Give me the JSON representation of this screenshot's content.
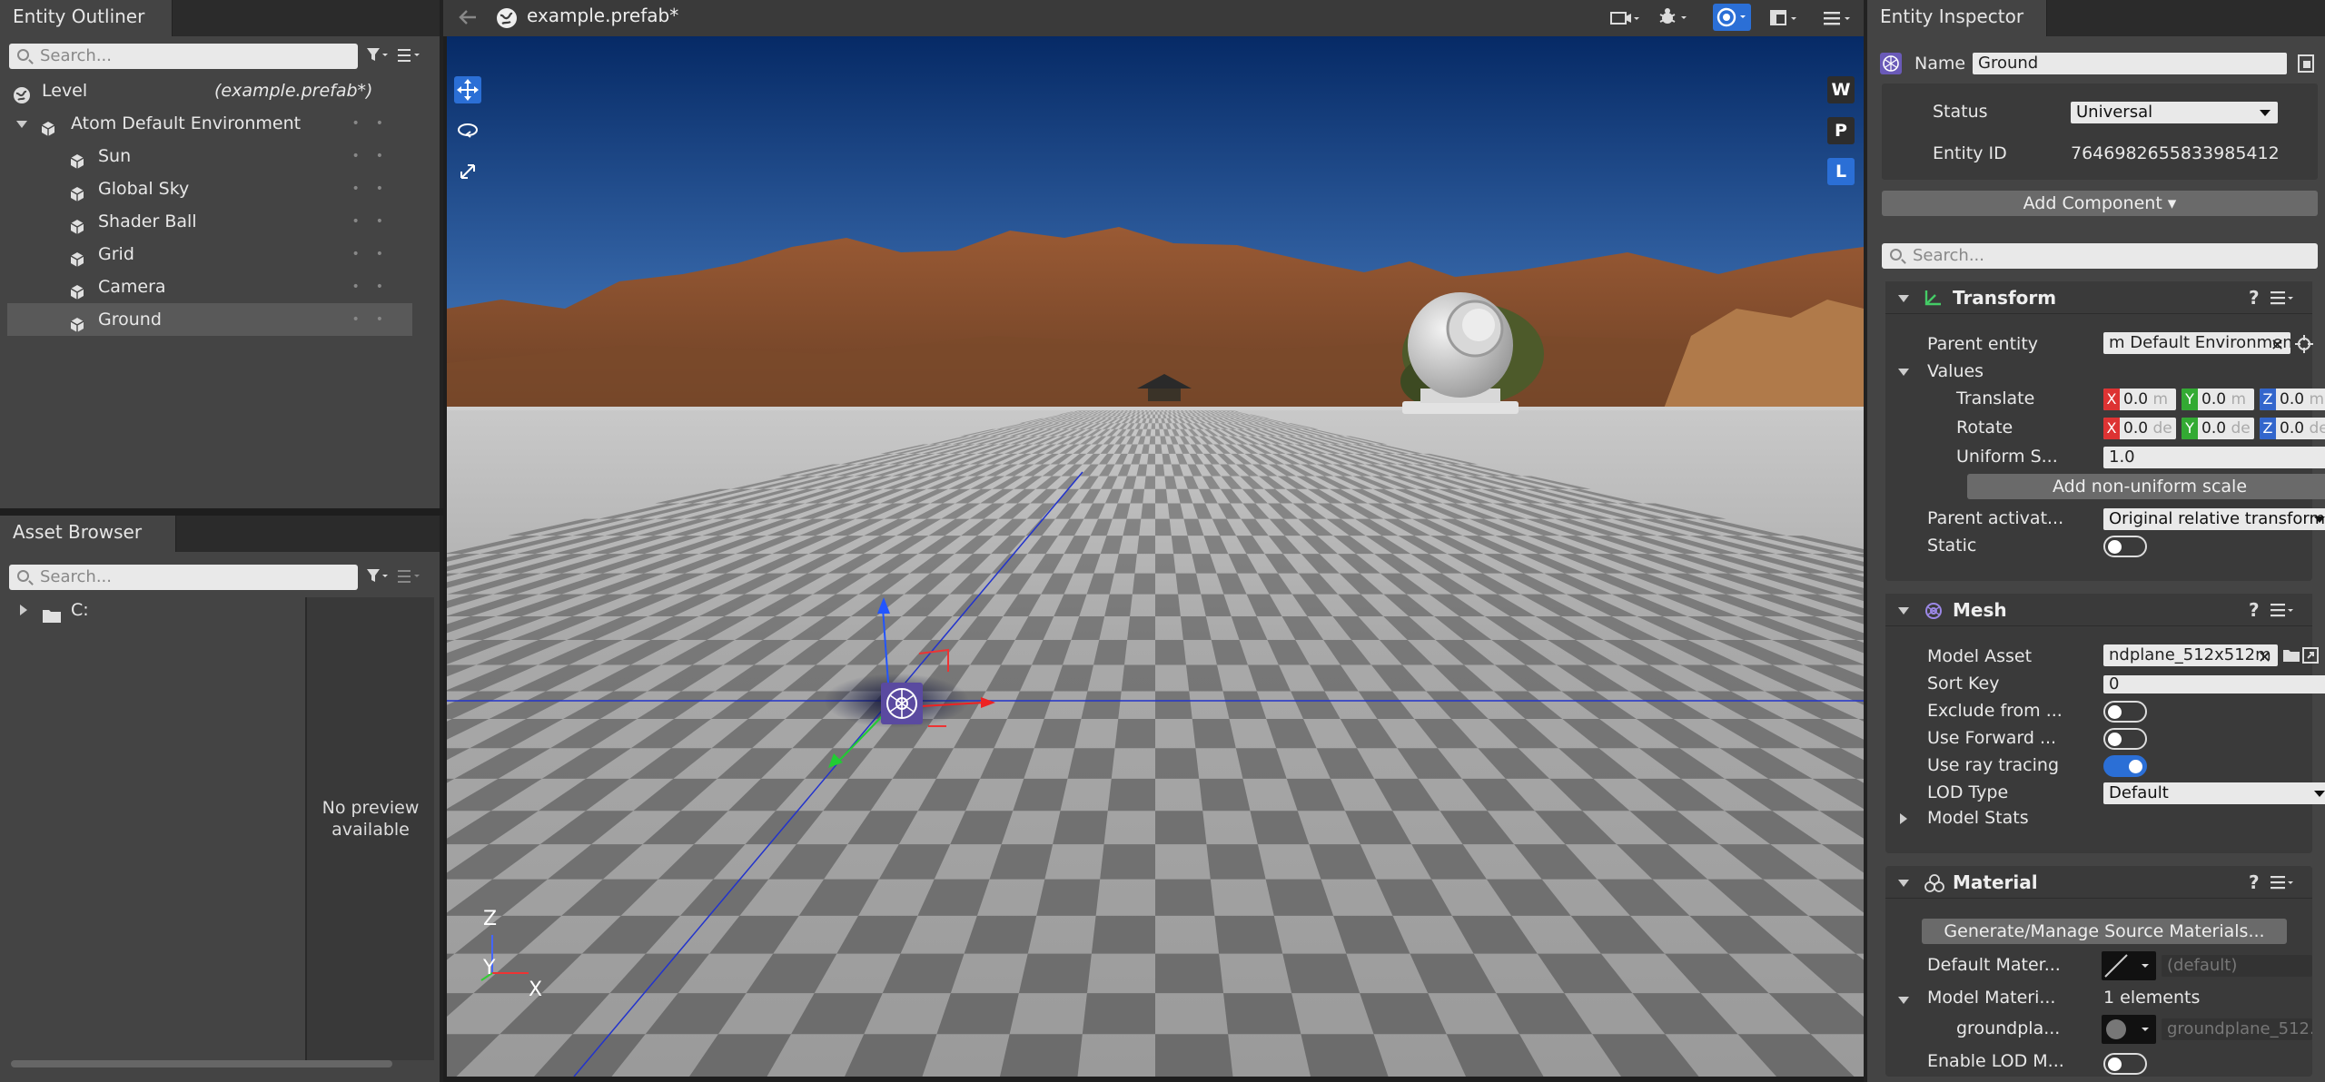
{
  "outliner": {
    "tab": "Entity Outliner",
    "search_placeholder": "Search...",
    "level_label": "Level",
    "level_file": "(example.prefab*)",
    "root": "Atom Default Environment",
    "children": [
      "Sun",
      "Global Sky",
      "Shader Ball",
      "Grid",
      "Camera",
      "Ground"
    ],
    "selected": "Ground",
    "icons": {
      "filter": "filter-icon",
      "menu": "hamburger-icon",
      "entity": "cube-icon"
    }
  },
  "asset_browser": {
    "tab": "Asset Browser",
    "search_placeholder": "Search...",
    "folder": "C:",
    "preview_text": "No preview available"
  },
  "viewport": {
    "file": "example.prefab*",
    "side_buttons": [
      "W",
      "P",
      "L"
    ],
    "active_side_button": "L",
    "axis_labels": {
      "z": "Z",
      "y": "Y",
      "x": "X"
    },
    "toolbar_icons": [
      "back-arrow-icon",
      "globe-icon",
      "camera-icon",
      "bug-icon",
      "eye-icon",
      "layout-icon",
      "hamburger-icon"
    ],
    "left_tools": [
      "move-tool-icon",
      "rotate-tool-icon",
      "scale-tool-icon"
    ],
    "colors": {
      "sky_top": "#062a66",
      "sky_bottom": "#3f76bc",
      "accent": "#2b6fd6"
    }
  },
  "inspector": {
    "tab": "Entity Inspector",
    "name_label": "Name",
    "name_value": "Ground",
    "status_label": "Status",
    "status_value": "Universal",
    "entity_id_label": "Entity ID",
    "entity_id_value": "7646982655833985412",
    "add_component": "Add Component ▾",
    "search_placeholder": "Search...",
    "transform": {
      "title": "Transform",
      "parent_entity_label": "Parent entity",
      "parent_entity_value": "m Default Environment",
      "values_label": "Values",
      "translate_label": "Translate",
      "rotate_label": "Rotate",
      "translate": {
        "x": "0.0",
        "y": "0.0",
        "z": "0.0",
        "unit": "m"
      },
      "rotate": {
        "x": "0.0",
        "y": "0.0",
        "z": "0.0",
        "unit": "de"
      },
      "uniform_label": "Uniform S...",
      "uniform_value": "1.0",
      "add_nonuniform": "Add non-uniform scale",
      "parent_activation_label": "Parent activat...",
      "parent_activation_value": "Original relative transform",
      "static_label": "Static",
      "static_on": false
    },
    "mesh": {
      "title": "Mesh",
      "model_asset_label": "Model Asset",
      "model_asset_value": "ndplane_512x512m",
      "sort_key_label": "Sort Key",
      "sort_key_value": "0",
      "exclude_label": "Exclude from ...",
      "exclude_on": false,
      "use_forward_label": "Use Forward ...",
      "use_forward_on": false,
      "ray_tracing_label": "Use ray tracing",
      "ray_tracing_on": true,
      "lod_type_label": "LOD Type",
      "lod_type_value": "Default",
      "model_stats_label": "Model Stats"
    },
    "material": {
      "title": "Material",
      "generate_button": "Generate/Manage Source Materials...",
      "default_material_label": "Default Mater...",
      "default_material_value": "(default)",
      "model_materials_label": "Model Materi...",
      "model_materials_count": "1 elements",
      "slot_label": "groundpla...",
      "slot_value": "groundplane_512...",
      "enable_lod_label": "Enable LOD M..."
    }
  }
}
